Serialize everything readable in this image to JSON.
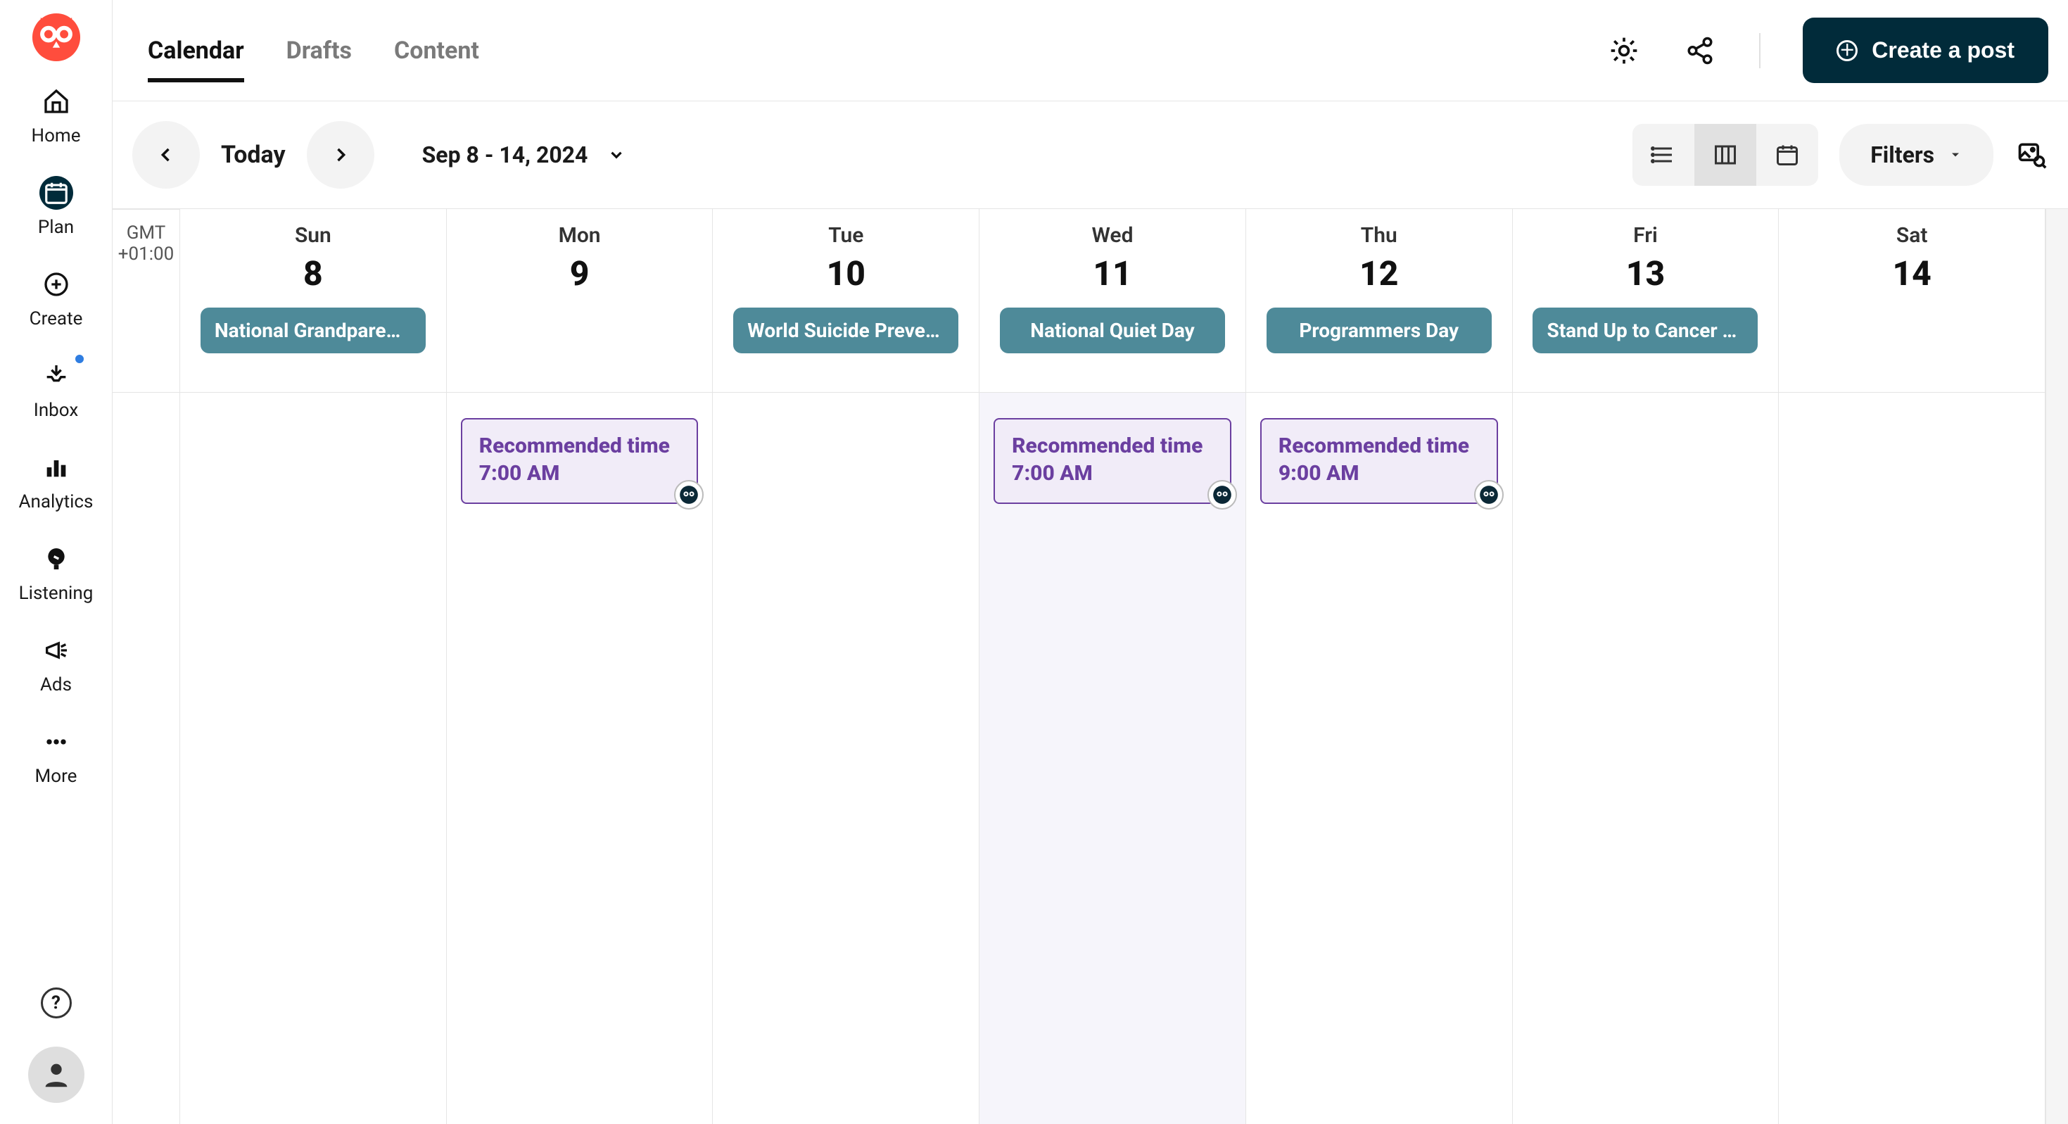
{
  "sidebar": {
    "items": [
      {
        "id": "home",
        "label": "Home"
      },
      {
        "id": "plan",
        "label": "Plan",
        "active": true
      },
      {
        "id": "create",
        "label": "Create"
      },
      {
        "id": "inbox",
        "label": "Inbox",
        "hasDot": true
      },
      {
        "id": "analytics",
        "label": "Analytics"
      },
      {
        "id": "listening",
        "label": "Listening"
      },
      {
        "id": "ads",
        "label": "Ads"
      },
      {
        "id": "more",
        "label": "More"
      }
    ]
  },
  "tabs": {
    "items": [
      {
        "id": "calendar",
        "label": "Calendar",
        "active": true
      },
      {
        "id": "drafts",
        "label": "Drafts"
      },
      {
        "id": "content",
        "label": "Content"
      }
    ]
  },
  "topbar": {
    "create_label": "Create a post"
  },
  "toolbar": {
    "today_label": "Today",
    "date_range": "Sep 8 - 14, 2024",
    "filters_label": "Filters"
  },
  "calendar": {
    "tz_line1": "GMT",
    "tz_line2": "+01:00",
    "days": [
      {
        "dow": "Sun",
        "num": "8",
        "pill": "National Grandparen…"
      },
      {
        "dow": "Mon",
        "num": "9",
        "pill": null,
        "rec": {
          "title": "Recommended time",
          "time": "7:00 AM"
        }
      },
      {
        "dow": "Tue",
        "num": "10",
        "pill": "World Suicide Preven…"
      },
      {
        "dow": "Wed",
        "num": "11",
        "pill": "National Quiet Day",
        "today": true,
        "rec": {
          "title": "Recommended time",
          "time": "7:00 AM"
        }
      },
      {
        "dow": "Thu",
        "num": "12",
        "pill": "Programmers Day",
        "rec": {
          "title": "Recommended time",
          "time": "9:00 AM"
        }
      },
      {
        "dow": "Fri",
        "num": "13",
        "pill": "Stand Up to Cancer Day"
      },
      {
        "dow": "Sat",
        "num": "14",
        "pill": null
      }
    ]
  }
}
